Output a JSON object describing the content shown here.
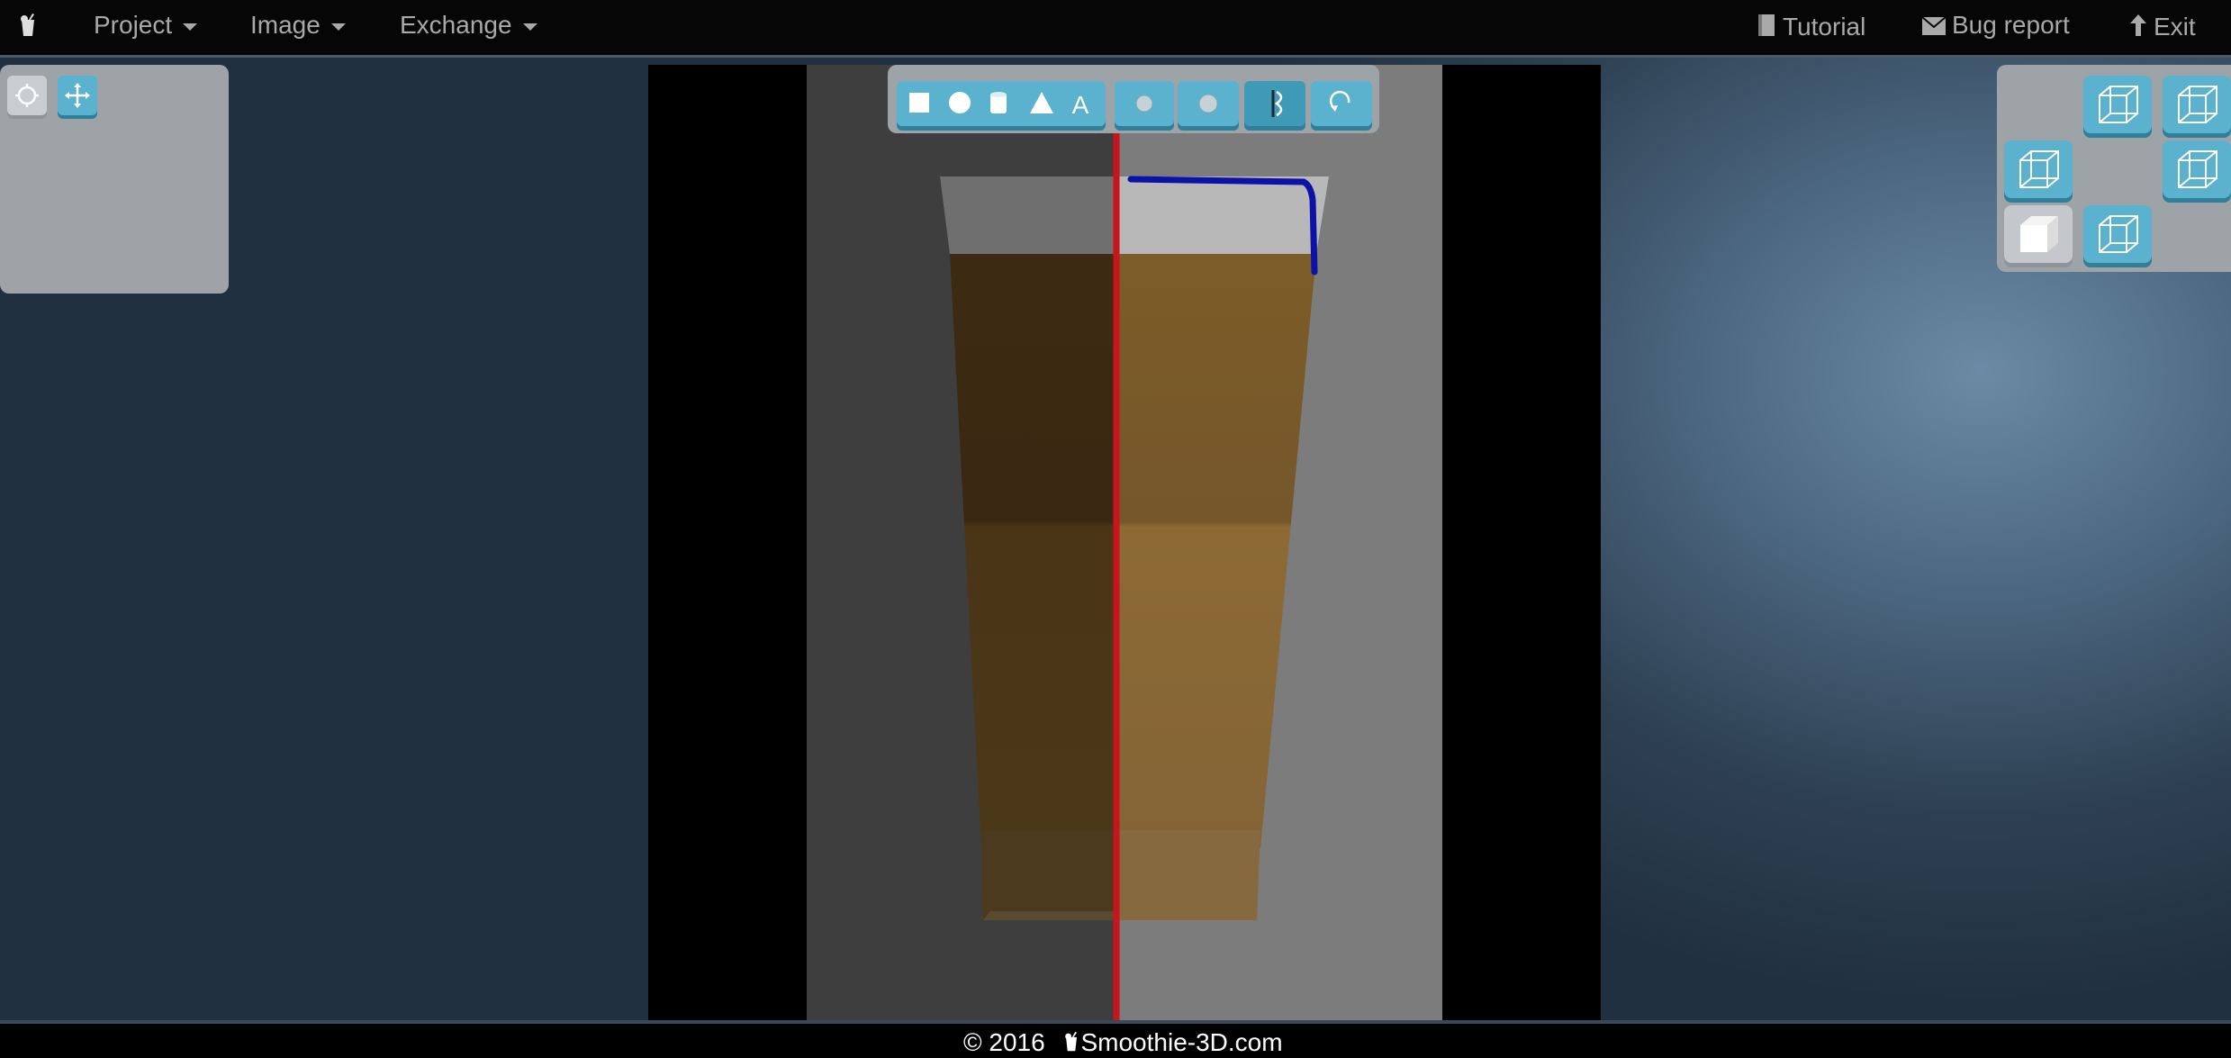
{
  "menubar": {
    "logo_icon": "smoothie-cup-icon",
    "items": [
      {
        "label": "Project"
      },
      {
        "label": "Image"
      },
      {
        "label": "Exchange"
      }
    ],
    "right_items": [
      {
        "label": "Tutorial",
        "icon": "book-icon"
      },
      {
        "label": "Bug report",
        "icon": "envelope-icon"
      },
      {
        "label": "Exit",
        "icon": "arrow-up-icon"
      }
    ]
  },
  "left_toolbar": {
    "tools": [
      {
        "name": "select-tool",
        "icon": "circle-select-icon",
        "active": true
      },
      {
        "name": "move-tool",
        "icon": "move-arrows-icon",
        "active": false
      }
    ]
  },
  "shape_toolbar": {
    "primitives": [
      "cube-icon",
      "sphere-icon",
      "cylinder-icon",
      "cone-icon",
      "text-icon"
    ],
    "text_tool_label": "A",
    "modifiers": [
      "smooth-icon",
      "inflate-icon",
      "mirror-icon",
      "rotate-icon"
    ]
  },
  "view_cube": {
    "views": [
      "view-front",
      "view-top",
      "view-left",
      "view-right",
      "view-perspective",
      "view-bottom"
    ],
    "active": "view-perspective"
  },
  "colors": {
    "accent": "#5ab2ce",
    "guide_line": "#c8141c",
    "stroke": "#0c12a6"
  },
  "footer": {
    "text": "© 2016",
    "brand": "Smoothie-3D.com"
  }
}
